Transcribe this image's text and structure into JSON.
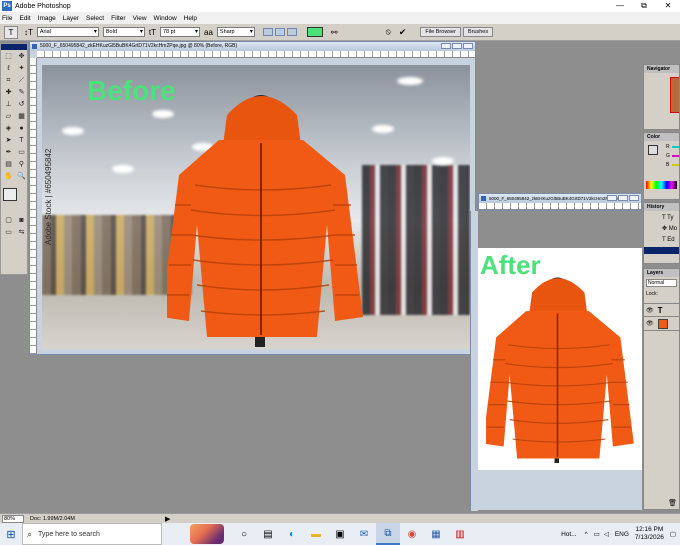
{
  "window": {
    "title": "Adobe Photoshop",
    "controls": [
      "—",
      "⧉",
      "✕"
    ]
  },
  "menu": [
    "File",
    "Edit",
    "Image",
    "Layer",
    "Select",
    "Filter",
    "View",
    "Window",
    "Help"
  ],
  "options": {
    "font_family": "Arial",
    "font_style": "Bold",
    "font_size": "78 pt",
    "anti_alias": "Sharp",
    "text_color": "#4ee07a",
    "tabs": [
      "File Browser",
      "Brushes"
    ]
  },
  "documents": {
    "before": {
      "title": "5000_F_650495842_zkEHKuzGl5BuBK4GrtD71V2kcHm2Pqe.jpg @ 80% (Before, RGB)",
      "label": "Before",
      "watermark": "Adobe Stock | #650495842"
    },
    "after": {
      "title": "5000_F_650495842_zkEHKuzGl5BuBK4GrtD71V2kcHm2Pqe.jpg",
      "label": "After"
    }
  },
  "palettes": {
    "navigator": "Navigator",
    "color": "Color",
    "color_channels": [
      "R",
      "G",
      "B"
    ],
    "history": "History",
    "history_items": [
      "Ty",
      "Mo",
      "Ed"
    ],
    "layers": "Layers",
    "blend_mode": "Normal",
    "lock_label": "Lock:"
  },
  "status": {
    "zoom": "80%",
    "doc_size": "Doc: 1.99M/2.04M"
  },
  "taskbar": {
    "search_placeholder": "Type here to search",
    "weather": "Hot...",
    "language": "ENG",
    "time": "12:16 PM",
    "date": "7/13/2026"
  },
  "colors": {
    "accent_green": "#4ee07a",
    "jacket_orange": "#f05a14"
  }
}
